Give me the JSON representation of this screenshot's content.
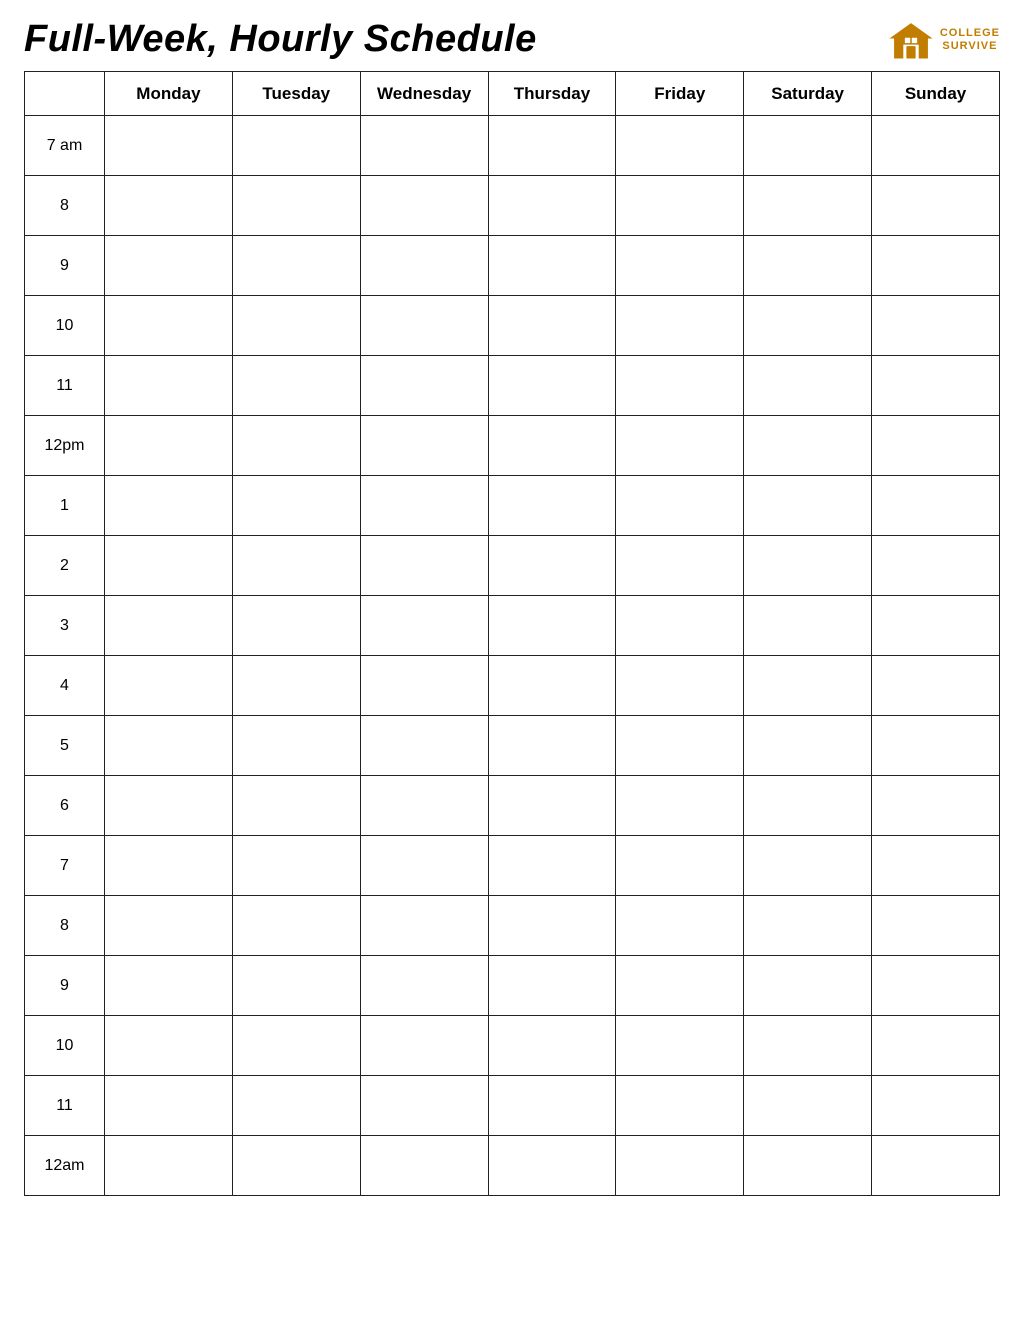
{
  "header": {
    "title": "Full-Week, Hourly Schedule",
    "logo": {
      "line1": "COLLEGE",
      "line2": "SURVIVE"
    }
  },
  "columns": {
    "time_label": "",
    "days": [
      "Monday",
      "Tuesday",
      "Wednesday",
      "Thursday",
      "Friday",
      "Saturday",
      "Sunday"
    ]
  },
  "time_slots": [
    "7 am",
    "8",
    "9",
    "10",
    "11",
    "12pm",
    "1",
    "2",
    "3",
    "4",
    "5",
    "6",
    "7",
    "8",
    "9",
    "10",
    "11",
    "12am"
  ]
}
